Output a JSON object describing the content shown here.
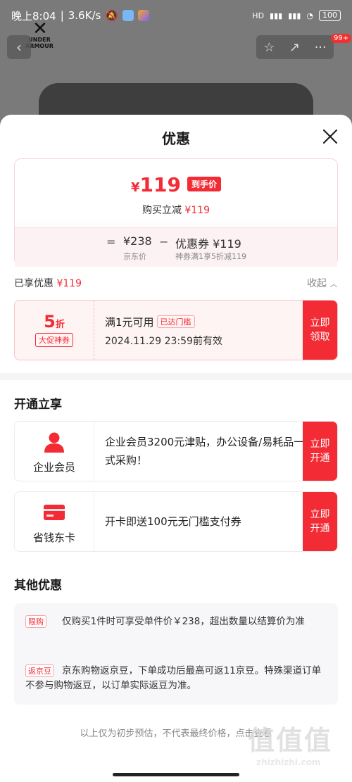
{
  "status_bar": {
    "time": "晚上8:04",
    "speed": "3.6K/s",
    "network": "HD",
    "battery": "100"
  },
  "background": {
    "brand_name": "UNDER ARMOUR",
    "cart_badge": "99+"
  },
  "sheet": {
    "title": "优惠",
    "price": {
      "currency": "¥",
      "amount": "119",
      "tag": "到手价",
      "sub_label": "购买立减",
      "sub_value": "¥119"
    },
    "formula": {
      "eq": "=",
      "base_value": "¥238",
      "base_caption": "京东价",
      "minus": "−",
      "coupon_value": "优惠券 ¥119",
      "coupon_caption": "神券满1享5折减119"
    },
    "enjoyed_label": "已享优惠",
    "enjoyed_value": "¥119",
    "collapse_label": "收起",
    "coupon": {
      "discount": "5",
      "discount_unit": "折",
      "tag": "大促神券",
      "condition": "满1元可用",
      "status": "已达门槛",
      "expiry": "2024.11.29 23:59前有效",
      "button_line1": "立即",
      "button_line2": "领取"
    },
    "open_section": {
      "heading": "开通立享",
      "cards": [
        {
          "label": "企业会员",
          "text": "企业会员3200元津贴，办公设备/易耗品一站式采购！",
          "button_line1": "立即",
          "button_line2": "开通"
        },
        {
          "label": "省钱东卡",
          "text": "开卡即送100元无门槛支付券",
          "button_line1": "立即",
          "button_line2": "开通"
        }
      ]
    },
    "other_section": {
      "heading": "其他优惠",
      "items": [
        {
          "tag": "限购",
          "text": "仅购买1件时可享受单件价￥238，超出数量以结算价为准"
        },
        {
          "tag": "返京豆",
          "text": "京东购物返京豆，下单成功后最高可返11京豆。特殊渠道订单不参与购物返豆，以订单实际返豆为准。"
        }
      ]
    },
    "footer_note": "以上仅为初步预估，不代表最终价格，点击查看",
    "watermark_big": "值值值",
    "watermark_small": "zhizhizhi.com"
  },
  "colors": {
    "accent": "#f22b35",
    "overlay": "#6b6b6b"
  }
}
